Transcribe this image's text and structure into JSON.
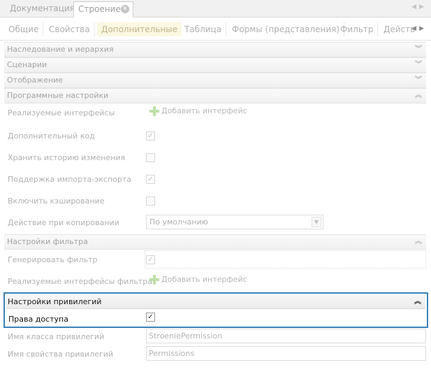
{
  "doc_tabs": [
    {
      "label": "Документация"
    },
    {
      "label": "Строение"
    }
  ],
  "section_tabs": [
    {
      "label": "Общие"
    },
    {
      "label": "Свойства"
    },
    {
      "label": "Дополнительные"
    },
    {
      "label": "Таблица"
    },
    {
      "label": "Формы (представления)"
    },
    {
      "label": "Фильтр"
    },
    {
      "label": "Действ"
    }
  ],
  "groups": {
    "inheritance": "Наследование и иерархия",
    "scenarios": "Сценарии",
    "display": "Отображение",
    "program": "Программные настройки",
    "filter": "Настройки фильтра",
    "privileges": "Настройки привилегий"
  },
  "program": {
    "interfaces_label": "Реализуемые интерфейсы",
    "add_interface": "Добавить интерфейс",
    "extra_code_label": "Дополнительный код",
    "extra_code_checked": true,
    "history_label": "Хранить историю изменения",
    "history_checked": false,
    "import_export_label": "Поддержка импорта-экспорта",
    "import_export_checked": true,
    "cache_label": "Включить кэширование",
    "cache_checked": false,
    "copy_action_label": "Действие при копировании",
    "copy_action_value": "По умолчанию"
  },
  "filter": {
    "generate_label": "Генерировать фильтр",
    "generate_checked": true,
    "interfaces_label": "Реализуемые интерфейсы фильтра",
    "add_interface": "Добавить интерфейс"
  },
  "privileges": {
    "access_label": "Права доступа",
    "access_checked": true,
    "class_name_label": "Имя класса привилегий",
    "class_name_value": "StroeniePermission",
    "property_name_label": "Имя свойства привилегий",
    "property_name_value": "Permissions"
  },
  "colors": {
    "highlight_border": "#3b82b8",
    "active_tab_bg": "#fbf8e2"
  }
}
